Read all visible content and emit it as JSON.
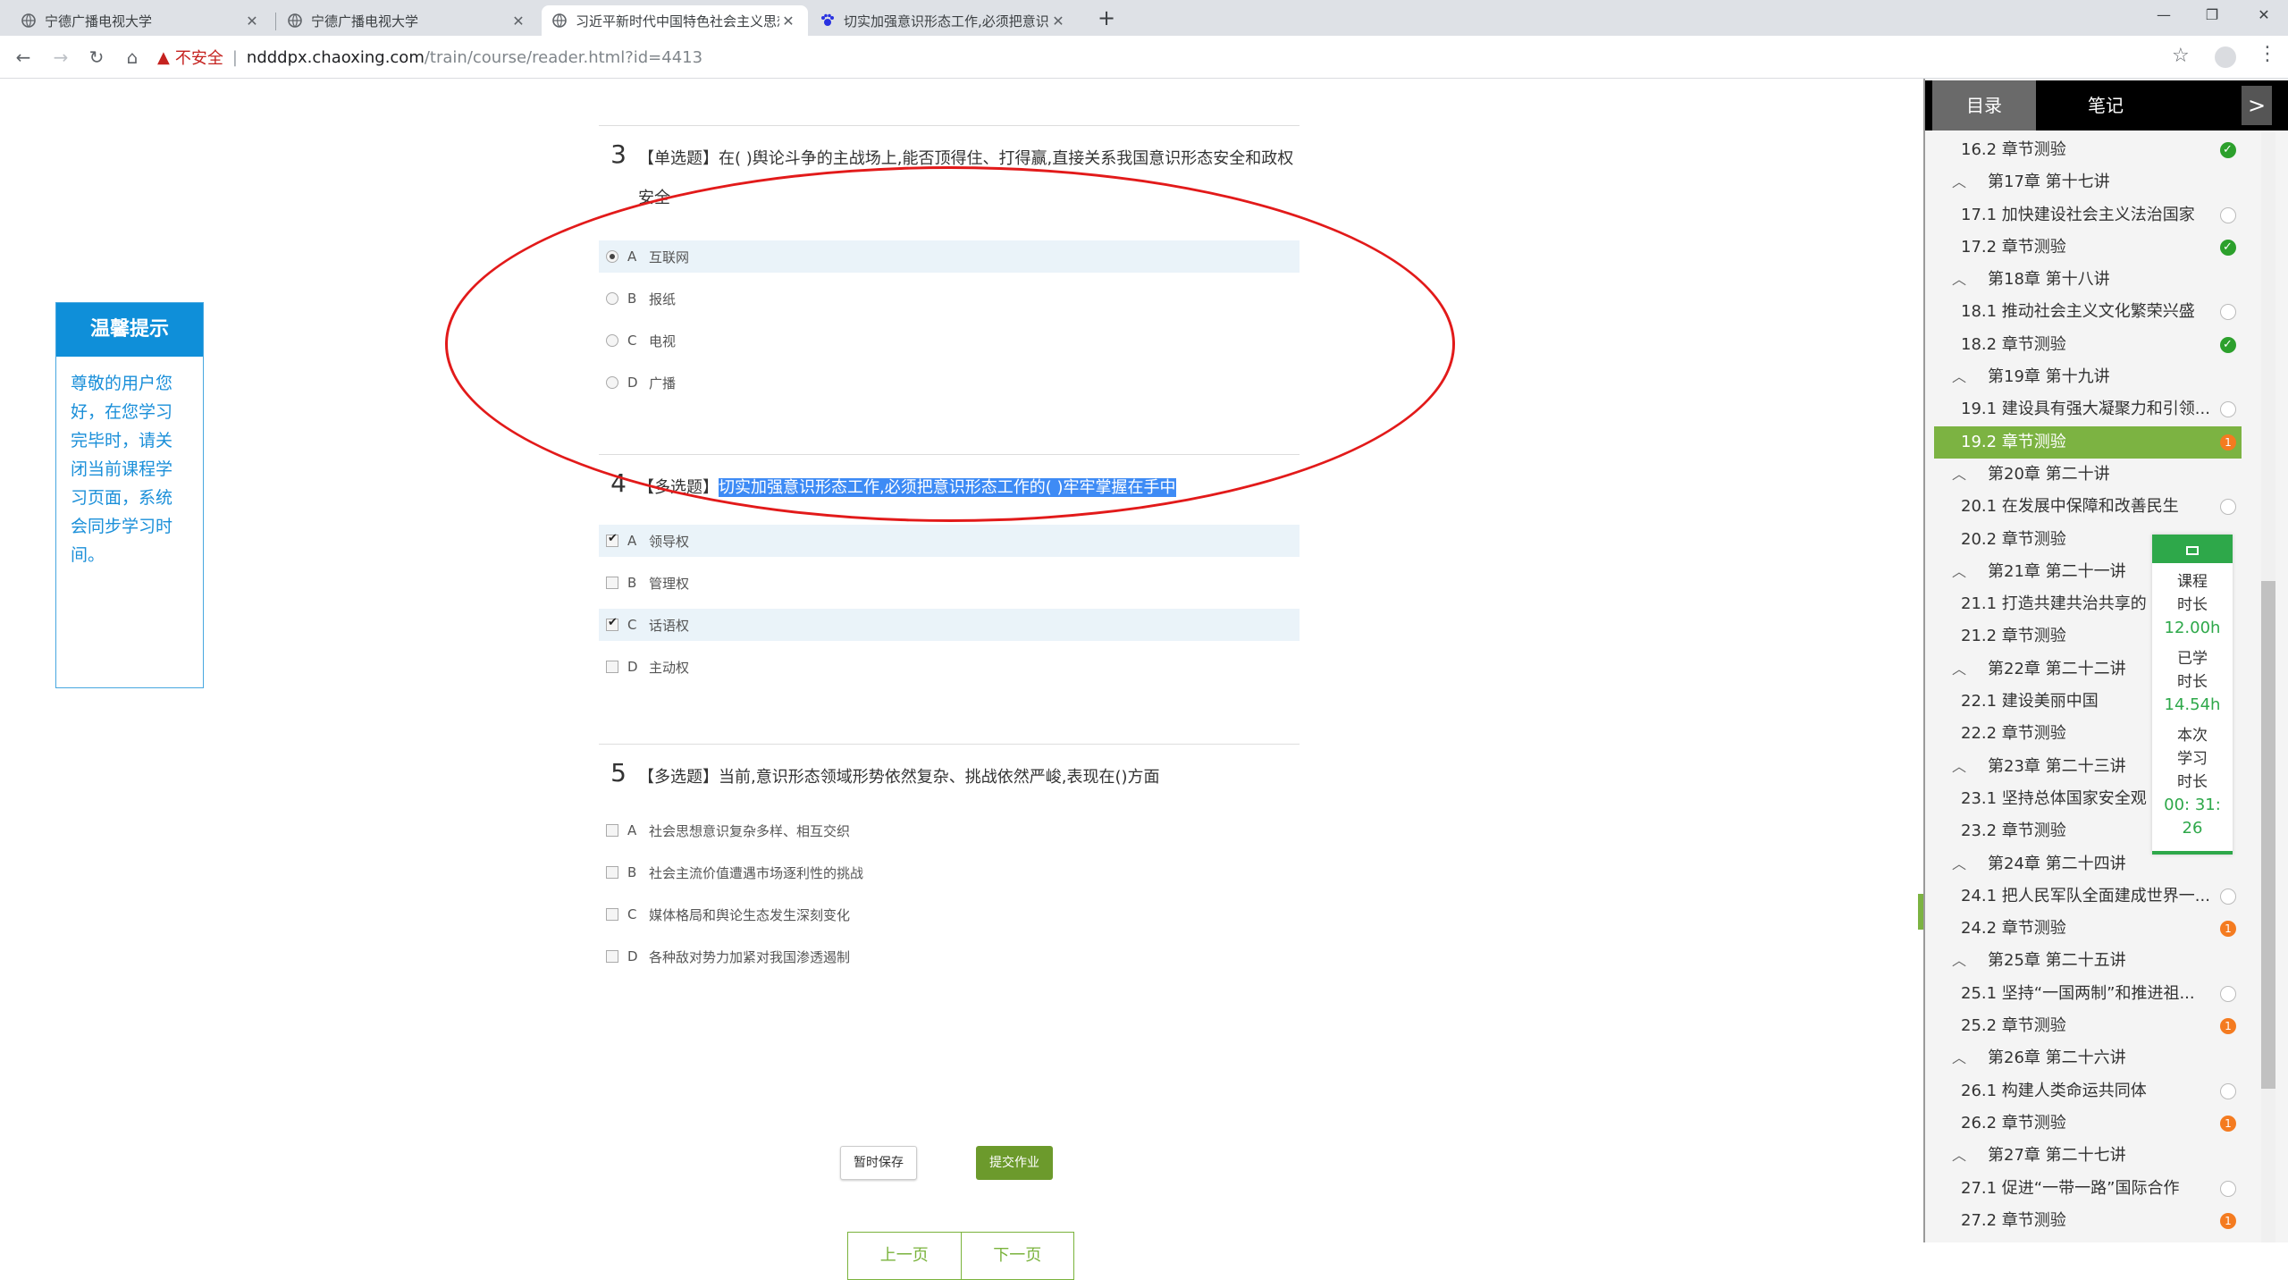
{
  "browser": {
    "tabs": [
      {
        "title": "宁德广播电视大学",
        "active": false
      },
      {
        "title": "宁德广播电视大学",
        "active": false
      },
      {
        "title": "习近平新时代中国特色社会主义思想概论",
        "active": true
      },
      {
        "title": "切实加强意识形态工作,必须把意识形态工作",
        "active": false
      }
    ],
    "new_tab": "+",
    "insecure": "不安全",
    "url_host": "ndddpx.chaoxing.com",
    "url_path": "/train/course/reader.html?id=4413"
  },
  "tip": {
    "title": "温馨提示",
    "body": "尊敬的用户您好，在您学习完毕时，请关闭当前课程学习页面，系统会同步学习时间。"
  },
  "questions": [
    {
      "num": "3",
      "type": "【单选题】",
      "text": "在( )舆论斗争的主战场上,能否顶得住、打得赢,直接关系我国意识形态安全和政权安全",
      "options": [
        {
          "letter": "A",
          "text": "互联网",
          "checked": true
        },
        {
          "letter": "B",
          "text": "报纸",
          "checked": false
        },
        {
          "letter": "C",
          "text": "电视",
          "checked": false
        },
        {
          "letter": "D",
          "text": "广播",
          "checked": false
        }
      ]
    },
    {
      "num": "4",
      "type": "【多选题】",
      "text": "切实加强意识形态工作,必须把意识形态工作的( )牢牢掌握在手中",
      "options": [
        {
          "letter": "A",
          "text": "领导权",
          "checked": true
        },
        {
          "letter": "B",
          "text": "管理权",
          "checked": false
        },
        {
          "letter": "C",
          "text": "话语权",
          "checked": true
        },
        {
          "letter": "D",
          "text": "主动权",
          "checked": false
        }
      ]
    },
    {
      "num": "5",
      "type": "【多选题】",
      "text": "当前,意识形态领域形势依然复杂、挑战依然严峻,表现在()方面",
      "options": [
        {
          "letter": "A",
          "text": "社会思想意识复杂多样、相互交织",
          "checked": false
        },
        {
          "letter": "B",
          "text": "社会主流价值遭遇市场逐利性的挑战",
          "checked": false
        },
        {
          "letter": "C",
          "text": "媒体格局和舆论生态发生深刻变化",
          "checked": false
        },
        {
          "letter": "D",
          "text": "各种敌对势力加紧对我国渗透遏制",
          "checked": false
        }
      ]
    }
  ],
  "actions": {
    "save": "暂时保存",
    "submit": "提交作业",
    "prev": "上一页",
    "next": "下一页"
  },
  "sidebar": {
    "tab_toc": "目录",
    "tab_notes": "笔记",
    "arrow": ">",
    "items": [
      {
        "kind": "sec",
        "text": "16.2 章节测验",
        "status": "done"
      },
      {
        "kind": "ch",
        "text": "第17章 第十七讲"
      },
      {
        "kind": "sec",
        "text": "17.1 加快建设社会主义法治国家",
        "status": "empty"
      },
      {
        "kind": "sec",
        "text": "17.2 章节测验",
        "status": "done"
      },
      {
        "kind": "ch",
        "text": "第18章 第十八讲"
      },
      {
        "kind": "sec",
        "text": "18.1 推动社会主义文化繁荣兴盛",
        "status": "empty"
      },
      {
        "kind": "sec",
        "text": "18.2 章节测验",
        "status": "done"
      },
      {
        "kind": "ch",
        "text": "第19章 第十九讲"
      },
      {
        "kind": "sec",
        "text": "19.1 建设具有强大凝聚力和引领...",
        "status": "empty"
      },
      {
        "kind": "sec",
        "text": "19.2 章节测验",
        "status": "pend",
        "active": true
      },
      {
        "kind": "ch",
        "text": "第20章 第二十讲"
      },
      {
        "kind": "sec",
        "text": "20.1 在发展中保障和改善民生",
        "status": "empty"
      },
      {
        "kind": "sec",
        "text": "20.2 章节测验",
        "status": "none"
      },
      {
        "kind": "ch",
        "text": "第21章 第二十一讲"
      },
      {
        "kind": "sec",
        "text": "21.1 打造共建共治共享的",
        "status": "none"
      },
      {
        "kind": "sec",
        "text": "21.2 章节测验",
        "status": "none"
      },
      {
        "kind": "ch",
        "text": "第22章 第二十二讲"
      },
      {
        "kind": "sec",
        "text": "22.1 建设美丽中国",
        "status": "none"
      },
      {
        "kind": "sec",
        "text": "22.2 章节测验",
        "status": "none"
      },
      {
        "kind": "ch",
        "text": "第23章 第二十三讲"
      },
      {
        "kind": "sec",
        "text": "23.1 坚持总体国家安全观",
        "status": "none"
      },
      {
        "kind": "sec",
        "text": "23.2 章节测验",
        "status": "none"
      },
      {
        "kind": "ch",
        "text": "第24章 第二十四讲"
      },
      {
        "kind": "sec",
        "text": "24.1 把人民军队全面建成世界一...",
        "status": "empty"
      },
      {
        "kind": "sec",
        "text": "24.2 章节测验",
        "status": "pend"
      },
      {
        "kind": "ch",
        "text": "第25章 第二十五讲"
      },
      {
        "kind": "sec",
        "text": "25.1 坚持“一国两制”和推进祖...",
        "status": "empty"
      },
      {
        "kind": "sec",
        "text": "25.2 章节测验",
        "status": "pend"
      },
      {
        "kind": "ch",
        "text": "第26章 第二十六讲"
      },
      {
        "kind": "sec",
        "text": "26.1 构建人类命运共同体",
        "status": "empty"
      },
      {
        "kind": "sec",
        "text": "26.2 章节测验",
        "status": "pend"
      },
      {
        "kind": "ch",
        "text": "第27章 第二十七讲"
      },
      {
        "kind": "sec",
        "text": "27.1 促进“一带一路”国际合作",
        "status": "empty"
      },
      {
        "kind": "sec",
        "text": "27.2 章节测验",
        "status": "pend"
      }
    ],
    "pending_badge": "1"
  },
  "timer": {
    "course_label": "课程时长",
    "course_val": "12.00h",
    "studied_label": "已学时长",
    "studied_val": "14.54h",
    "session_label": "本次学习时长",
    "session_val": "00: 31: 26"
  }
}
